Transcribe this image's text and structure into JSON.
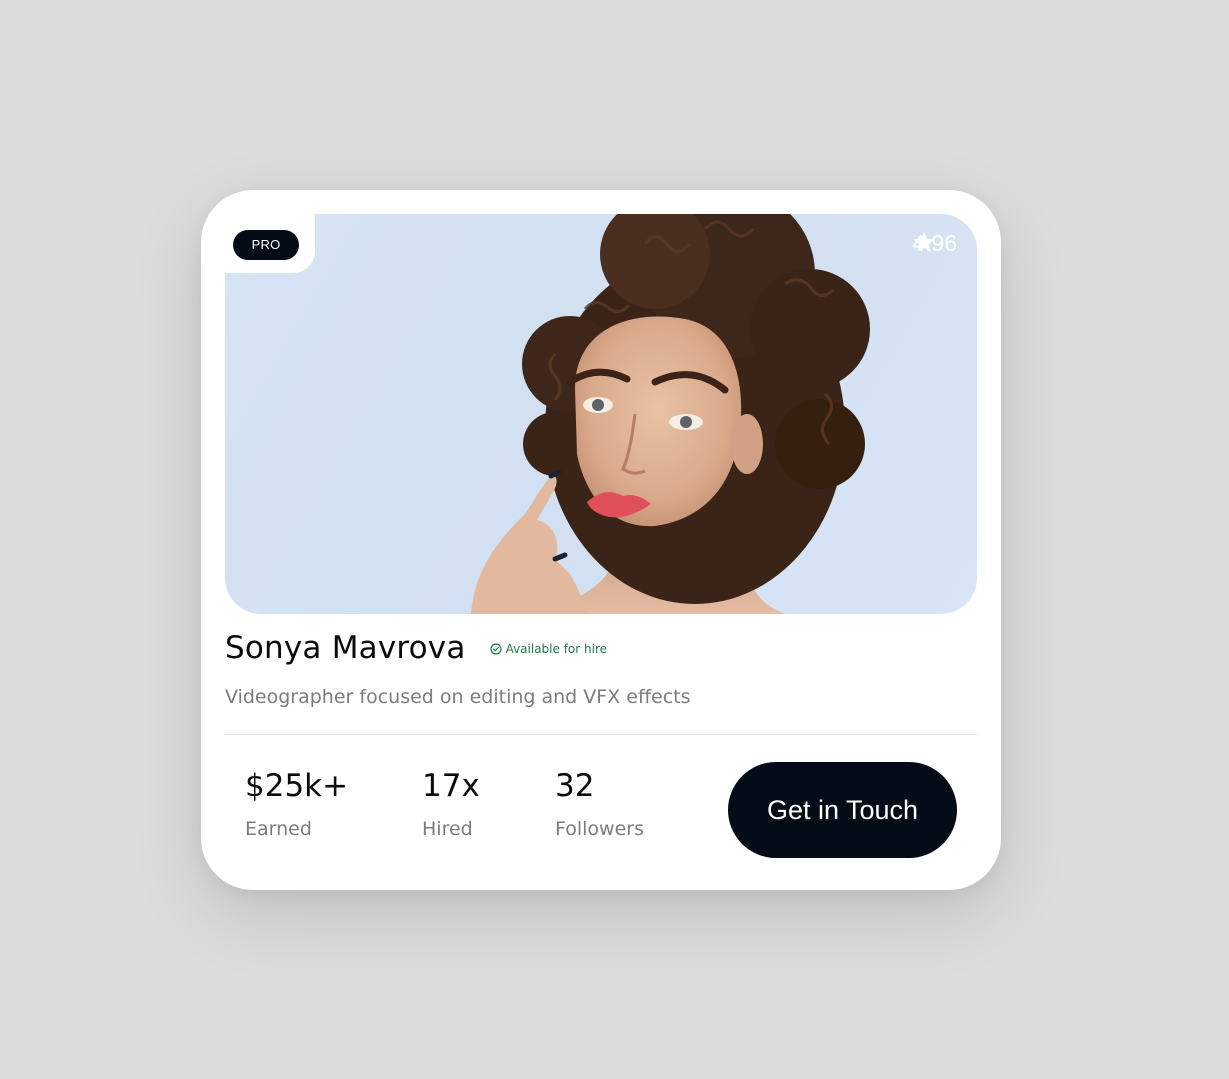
{
  "profile": {
    "badge": "PRO",
    "rating": "4.96",
    "name": "Sonya Mavrova",
    "availability": "Available for hire",
    "title": "Videographer focused on editing and VFX effects"
  },
  "stats": [
    {
      "value": "$25k+",
      "label": "Earned"
    },
    {
      "value": "17x",
      "label": "Hired"
    },
    {
      "value": "32",
      "label": "Followers"
    }
  ],
  "cta": {
    "label": "Get in Touch"
  },
  "colors": {
    "background": "#dcdcdc",
    "card": "#ffffff",
    "dark": "#040d17",
    "available_green": "#1d7a47",
    "muted_text": "#7c7c7c",
    "photo_bg": "#d6e4f4"
  },
  "icons": {
    "rating": "star-icon",
    "availability": "check-circle-icon"
  }
}
